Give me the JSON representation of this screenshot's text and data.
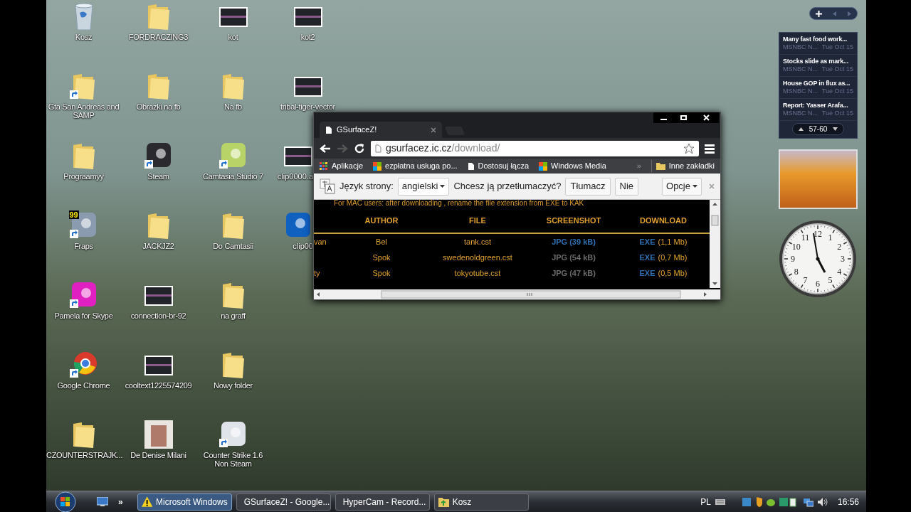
{
  "desktop": {
    "icons": [
      {
        "label": "Kosz",
        "kind": "bin",
        "shortcut": false,
        "covered": false
      },
      {
        "label": "Gta San Andreas and SAMP",
        "kind": "folder",
        "shortcut": true,
        "covered": false
      },
      {
        "label": "Prograamyy",
        "kind": "folder",
        "shortcut": false,
        "covered": false
      },
      {
        "label": "Fraps",
        "kind": "app",
        "color": "#8a9bb0",
        "badge": "99",
        "shortcut": true,
        "covered": false
      },
      {
        "label": "Pamela for Skype",
        "kind": "app",
        "color": "#e020c0",
        "shortcut": true,
        "covered": false
      },
      {
        "label": "Google Chrome",
        "kind": "browser",
        "shortcut": true,
        "covered": false
      },
      {
        "label": "CZOUNTERSTRAJK...",
        "kind": "folder",
        "shortcut": false,
        "covered": false
      },
      {
        "label": "FORDRACZING3",
        "kind": "folder",
        "shortcut": false,
        "covered": false
      },
      {
        "label": "Obrazki na fb",
        "kind": "folder",
        "shortcut": false,
        "covered": false
      },
      {
        "label": "Steam",
        "kind": "app",
        "color": "#2a2a2e",
        "shortcut": true,
        "covered": false
      },
      {
        "label": "JACKJZ2",
        "kind": "folder",
        "shortcut": false,
        "covered": false
      },
      {
        "label": "connection-br-92",
        "kind": "image",
        "shortcut": false,
        "covered": false
      },
      {
        "label": "cooltext1225574209",
        "kind": "image",
        "shortcut": false,
        "covered": false
      },
      {
        "label": "De Denise Milani",
        "kind": "photo",
        "shortcut": false,
        "covered": false
      },
      {
        "label": "kot",
        "kind": "image",
        "shortcut": false,
        "covered": false
      },
      {
        "label": "Na fb",
        "kind": "folder",
        "shortcut": false,
        "covered": false
      },
      {
        "label": "Camtasia Studio 7",
        "kind": "app",
        "color": "#b8d468",
        "shortcut": true,
        "covered": false
      },
      {
        "label": "Do Camtasii",
        "kind": "folder",
        "shortcut": false,
        "covered": false
      },
      {
        "label": "na graff",
        "kind": "folder",
        "shortcut": false,
        "covered": false
      },
      {
        "label": "Nowy folder",
        "kind": "folder",
        "shortcut": false,
        "covered": false
      },
      {
        "label": "Counter Strike 1.6 Non Steam",
        "kind": "app",
        "color": "#dfe4ea",
        "shortcut": true,
        "covered": false
      },
      {
        "label": "kot2",
        "kind": "image",
        "shortcut": false,
        "covered": false
      },
      {
        "label": "tribal-tiger-vector",
        "kind": "image",
        "shortcut": false,
        "covered": false
      },
      {
        "label": "clip0000.a",
        "kind": "image",
        "shortcut": false,
        "covered": true
      },
      {
        "label": "clip00",
        "kind": "app",
        "color": "#1060c0",
        "shortcut": false,
        "covered": true
      }
    ]
  },
  "browser": {
    "tab": {
      "title": "GSurfaceZ!"
    },
    "address": {
      "host": "gsurfacez.ic.cz",
      "path": "/download/"
    },
    "bookmarks": [
      {
        "label": "Aplikacje",
        "kind": "apps"
      },
      {
        "label": "ezpłatna usługa po...",
        "kind": "site"
      },
      {
        "label": "Dostosuj łącza",
        "kind": "page"
      },
      {
        "label": "Windows Media",
        "kind": "site"
      }
    ],
    "bookmarks_overflow": "»",
    "other_bookmarks": "Inne zakładki",
    "translate_bar": {
      "label": "Język strony:",
      "language": "angielski",
      "question": "Chcesz ją przetłumaczyć?",
      "buttons": [
        "Tłumacz",
        "Nie"
      ],
      "options": "Opcje"
    },
    "page": {
      "notice": "For MAC users: after downloading , rename the file extension from EXE to KAK",
      "columns": [
        "AUTHOR",
        "FILE",
        "SCREENSHOT",
        "DOWNLOAD"
      ],
      "rows": [
        {
          "column_1": "van",
          "author": "Bel",
          "file": "tank.cst",
          "screenshot": "JPG (39 kB)",
          "screenshot_dim": false,
          "download": "EXE",
          "size": "(1,1 Mb)"
        },
        {
          "column_1": "",
          "author": "Spok",
          "file": "swedenoldgreen.cst",
          "screenshot": "JPG (54 kB)",
          "screenshot_dim": true,
          "download": "EXE",
          "size": "(0,7 Mb)"
        },
        {
          "column_1": "ty",
          "author": "Spok",
          "file": "tokyotube.cst",
          "screenshot": "JPG (47 kB)",
          "screenshot_dim": true,
          "download": "EXE",
          "size": "(0,5 Mb)"
        }
      ]
    }
  },
  "news": {
    "items": [
      {
        "title": "Many fast food work...",
        "source": "MSNBC N...",
        "date": "Tue Oct 15"
      },
      {
        "title": "Stocks slide as mark...",
        "source": "MSNBC N...",
        "date": "Tue Oct 15"
      },
      {
        "title": "House GOP in flux as...",
        "source": "MSNBC N...",
        "date": "Tue Oct 15"
      },
      {
        "title": "Report: Yasser Arafa...",
        "source": "MSNBC N...",
        "date": "Tue Oct 15"
      }
    ],
    "pager": "57-60"
  },
  "clock": {
    "numerals": [
      "12",
      "1",
      "2",
      "3",
      "4",
      "5",
      "6",
      "7",
      "8",
      "9",
      "10",
      "11"
    ]
  },
  "taskbar": {
    "overflow": "»",
    "tasks": [
      {
        "label": "Microsoft Windows",
        "kind": "warning",
        "selected": true
      },
      {
        "label": "GSurfaceZ! - Google...",
        "kind": "browser",
        "selected": false
      },
      {
        "label": "HyperCam - Record...",
        "kind": "recorder",
        "selected": false
      },
      {
        "label": "Kosz",
        "kind": "folder",
        "selected": false
      }
    ],
    "language": "PL",
    "time": "16:56"
  }
}
